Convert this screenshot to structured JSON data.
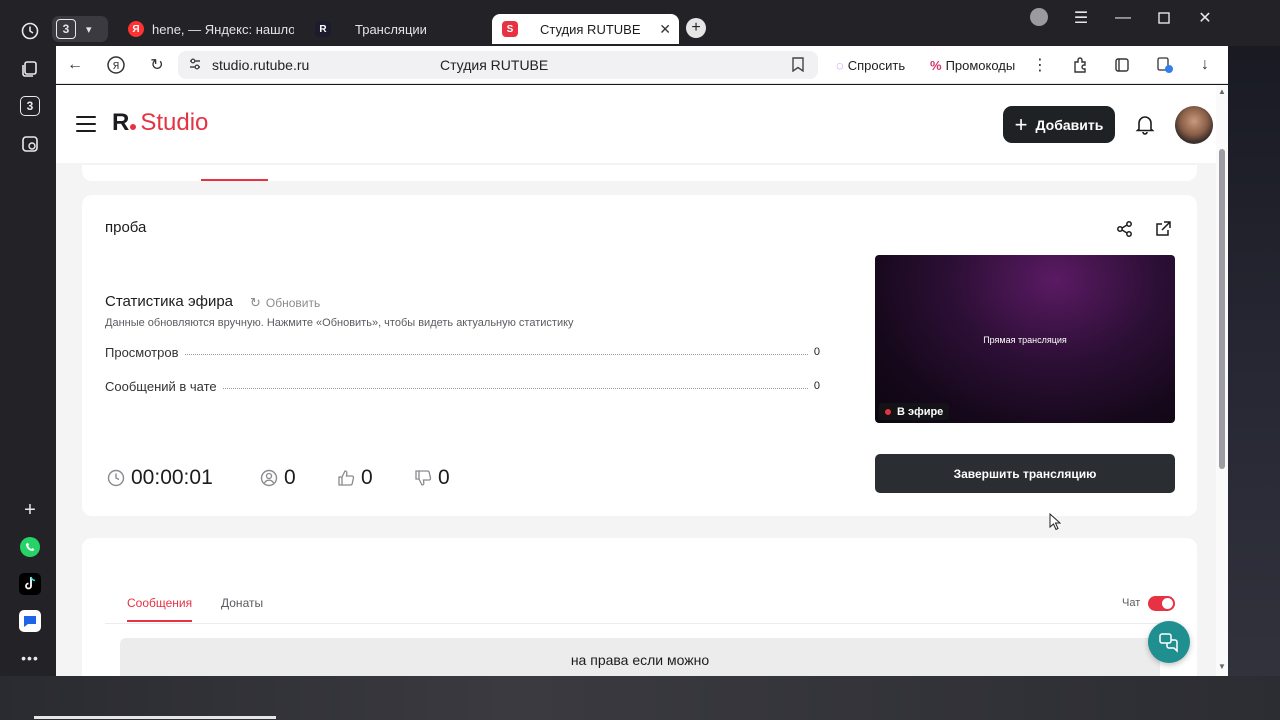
{
  "browser": {
    "tab_count": "3",
    "tabs": [
      {
        "label": "hene, — Яндекс: нашлось",
        "favicon": "Я"
      },
      {
        "label": "Трансляции",
        "favicon": "R"
      },
      {
        "label": "Студия RUTUBE",
        "favicon": "S"
      }
    ],
    "sidebar_count": "3",
    "url": "studio.rutube.ru",
    "page_title": "Студия RUTUBE",
    "ask_label": "Спросить",
    "promo_label": "Промокоды"
  },
  "header": {
    "logo_r": "R",
    "logo_studio": "Studio",
    "add_button": "Добавить"
  },
  "stream": {
    "title": "проба",
    "stats_heading": "Статистика эфира",
    "refresh_label": "Обновить",
    "stats_description": "Данные обновляются вручную. Нажмите «Обновить», чтобы видеть актуальную статистику",
    "rows": [
      {
        "label": "Просмотров",
        "value": "0"
      },
      {
        "label": "Сообщений в чате",
        "value": "0"
      }
    ],
    "duration": "00:00:01",
    "viewers": "0",
    "likes": "0",
    "dislikes": "0",
    "preview_text": "Прямая трансляция",
    "live_badge": "В эфире",
    "end_button": "Завершить трансляцию"
  },
  "chat": {
    "tabs": [
      "Сообщения",
      "Донаты"
    ],
    "toggle_label": "Чат",
    "toggle_on": true,
    "message": "на права если можно"
  },
  "colors": {
    "accent": "#e63242",
    "dark_button": "#1f2225",
    "fab": "#1f8f8f"
  }
}
